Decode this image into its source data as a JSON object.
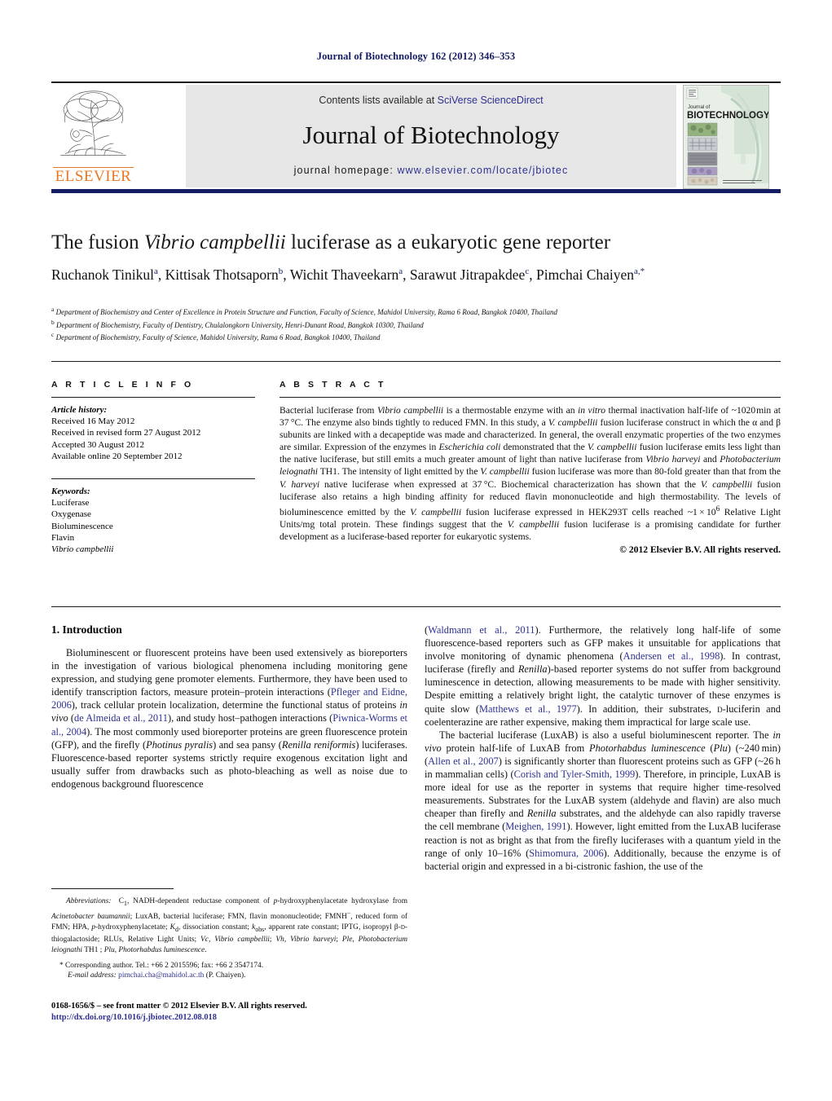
{
  "running_head": "Journal of Biotechnology 162 (2012) 346–353",
  "masthead": {
    "publisher_name": "ELSEVIER",
    "contents_prefix": "Contents lists available at ",
    "contents_link": "SciVerse ScienceDirect",
    "journal_title": "Journal of Biotechnology",
    "homepage_prefix": "journal homepage: ",
    "homepage_url": "www.elsevier.com/locate/jbiotec",
    "cover_title_small": "Journal of",
    "cover_title_large": "BIOTECHNOLOGY",
    "brand_orange": "#e87722",
    "link_blue": "#2e3192",
    "rule_navy": "#141c63"
  },
  "article": {
    "title_part1": "The fusion ",
    "title_italic": "Vibrio campbellii",
    "title_part2": " luciferase as a eukaryotic gene reporter",
    "authors": [
      {
        "name": "Ruchanok Tinikul",
        "sup": "a"
      },
      {
        "name": "Kittisak Thotsaporn",
        "sup": "b"
      },
      {
        "name": "Wichit Thaveekarn",
        "sup": "a"
      },
      {
        "name": "Sarawut Jitrapakdee",
        "sup": "c"
      },
      {
        "name": "Pimchai Chaiyen",
        "sup": "a,*"
      }
    ],
    "affiliations": [
      {
        "marker": "a",
        "text": "Department of Biochemistry and Center of Excellence in Protein Structure and Function, Faculty of Science, Mahidol University, Rama 6 Road, Bangkok 10400, Thailand"
      },
      {
        "marker": "b",
        "text": "Department of Biochemistry, Faculty of Dentistry, Chulalongkorn University, Henri-Dunant Road, Bangkok 10300, Thailand"
      },
      {
        "marker": "c",
        "text": "Department of Biochemistry, Faculty of Science, Mahidol University, Rama 6 Road, Bangkok 10400, Thailand"
      }
    ]
  },
  "article_info": {
    "heading": "A R T I C L E   I N F O",
    "history_label": "Article history:",
    "history": [
      "Received 16 May 2012",
      "Received in revised form 27 August 2012",
      "Accepted 30 August 2012",
      "Available online 20 September 2012"
    ],
    "keywords_label": "Keywords:",
    "keywords": [
      "Luciferase",
      "Oxygenase",
      "Bioluminescence",
      "Flavin",
      "Vibrio campbellii"
    ],
    "keyword_italic_index": 4
  },
  "abstract": {
    "heading": "A B S T R A C T",
    "copyright": "© 2012 Elsevier B.V. All rights reserved."
  },
  "introduction": {
    "heading": "1.  Introduction"
  },
  "footnotes": {
    "abbrev_label": "Abbreviations:",
    "corresponding": "* Corresponding author. Tel.: +66 2 2015596; fax: +66 2 3547174.",
    "email_label": "E-mail address:",
    "email": "pimchai.cha@mahidol.ac.th",
    "email_owner": "(P. Chaiyen)."
  },
  "footer": {
    "issn_line": "0168-1656/$ – see front matter © 2012 Elsevier B.V. All rights reserved.",
    "doi": "http://dx.doi.org/10.1016/j.jbiotec.2012.08.018"
  }
}
